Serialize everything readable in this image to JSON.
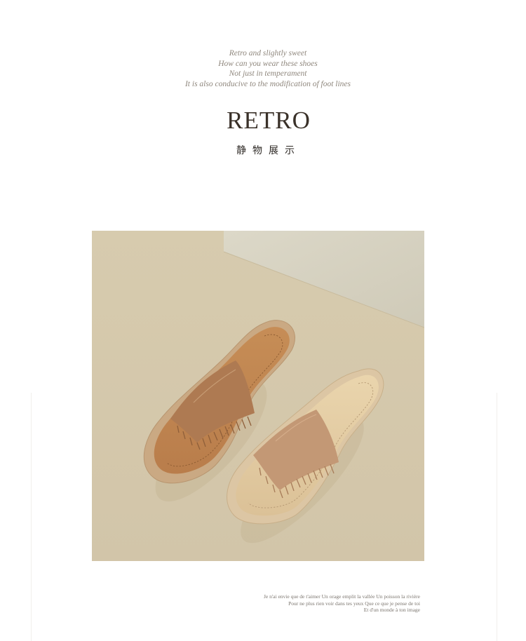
{
  "intro_lines": [
    "Retro and slightly sweet",
    "How can you wear these shoes",
    "Not just in temperament",
    "It is also conducive to the modification of foot lines"
  ],
  "title": "RETRO",
  "subtitle": "静物展示",
  "photo": {
    "subject": "two fringed suede flip-flop sandals on beige background",
    "colors": {
      "background": "#d9ccaf",
      "wall": "#d6d2c2",
      "sole_dark": "#c9a77e",
      "insole_dark": "#c18a57",
      "suede_dark": "#b27f57",
      "sole_light": "#dcc6a4",
      "insole_light": "#e0c89f",
      "suede_light": "#c49a76"
    }
  },
  "footer_lines": [
    "Je n'ai envie que de t'aimer Un orage emplit la vallée Un poisson la rivière",
    "Pour ne plus rien voir dans tes yeux Que ce que je pense de toi",
    "Et d'un monde à ton image"
  ]
}
